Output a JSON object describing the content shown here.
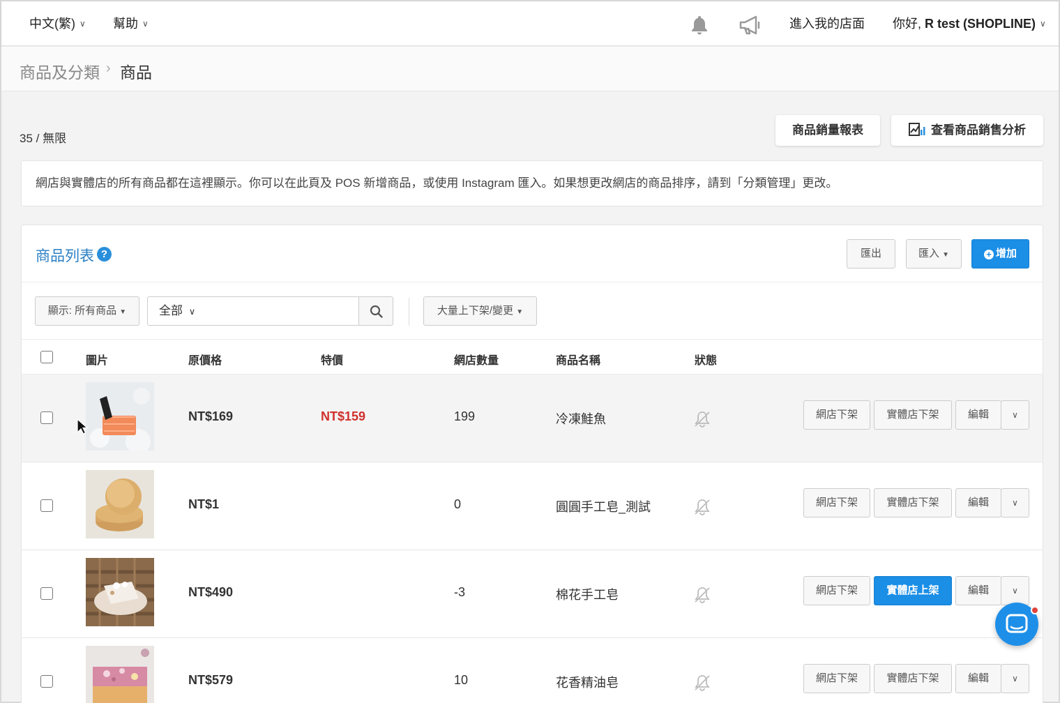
{
  "topbar": {
    "language": "中文(繁)",
    "help": "幫助",
    "enter_store": "進入我的店面",
    "greeting_prefix": "你好, ",
    "greeting_name": "R test (SHOPLINE)"
  },
  "breadcrumb": {
    "parent": "商品及分類",
    "separator": "›",
    "current": "商品"
  },
  "quota": "35 / 無限",
  "actions": {
    "sales_report": "商品銷量報表",
    "sales_analysis": "查看商品銷售分析"
  },
  "info_text": "網店與實體店的所有商品都在這裡顯示。你可以在此頁及 POS 新增商品，或使用 Instagram 匯入。如果想更改網店的商品排序，請到「分類管理」更改。",
  "panel": {
    "title": "商品列表",
    "help_glyph": "?",
    "export": "匯出",
    "import": "匯入",
    "add": "增加"
  },
  "filters": {
    "show": "顯示: 所有商品",
    "scope": "全部",
    "search_value": "",
    "bulk": "大量上下架/變更"
  },
  "columns": {
    "image": "圖片",
    "price": "原價格",
    "sale": "特價",
    "qty": "網店數量",
    "name": "商品名稱",
    "status": "狀態"
  },
  "rows": [
    {
      "price": "NT$169",
      "sale": "NT$159",
      "qty": "199",
      "name": "冷凍鮭魚",
      "online_btn": "網店下架",
      "store_btn": "實體店下架",
      "edit": "編輯",
      "image": "salmon"
    },
    {
      "price": "NT$1",
      "sale": "",
      "qty": "0",
      "name": "圓圓手工皂_測試",
      "online_btn": "網店下架",
      "store_btn": "實體店下架",
      "edit": "編輯",
      "image": "round-soap"
    },
    {
      "price": "NT$490",
      "sale": "",
      "qty": "-3",
      "name": "棉花手工皂",
      "online_btn": "網店下架",
      "store_btn": "實體店上架",
      "edit": "編輯",
      "image": "cotton-soap"
    },
    {
      "price": "NT$579",
      "sale": "",
      "qty": "10",
      "name": "花香精油皂",
      "online_btn": "網店下架",
      "store_btn": "實體店下架",
      "edit": "編輯",
      "image": "flower-soap"
    }
  ],
  "colors": {
    "primary": "#1b8ee6",
    "sale_red": "#d0312d",
    "title_blue": "#2a7fc4"
  },
  "icons": [
    "bell-icon",
    "megaphone-icon",
    "chart-icon",
    "help-icon",
    "plus-circle-icon",
    "search-icon",
    "caret-down-icon",
    "bell-off-icon",
    "chevron-down-icon",
    "chat-icon"
  ]
}
